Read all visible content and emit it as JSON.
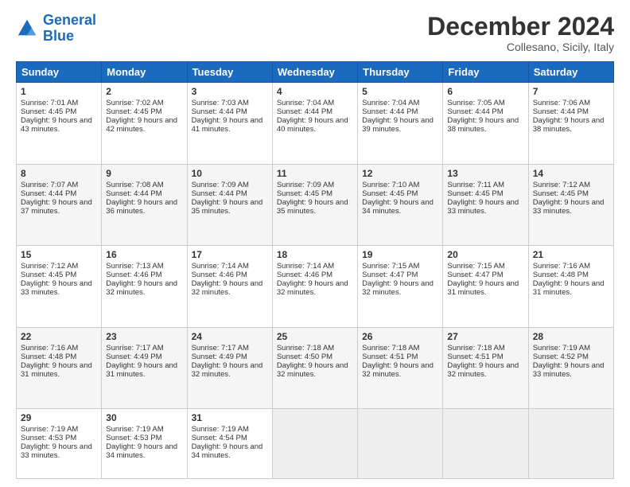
{
  "logo": {
    "line1": "General",
    "line2": "Blue"
  },
  "title": "December 2024",
  "subtitle": "Collesano, Sicily, Italy",
  "days": [
    "Sunday",
    "Monday",
    "Tuesday",
    "Wednesday",
    "Thursday",
    "Friday",
    "Saturday"
  ],
  "weeks": [
    [
      {
        "day": "1",
        "sunrise": "7:01 AM",
        "sunset": "4:45 PM",
        "daylight": "9 hours and 43 minutes."
      },
      {
        "day": "2",
        "sunrise": "7:02 AM",
        "sunset": "4:45 PM",
        "daylight": "9 hours and 42 minutes."
      },
      {
        "day": "3",
        "sunrise": "7:03 AM",
        "sunset": "4:44 PM",
        "daylight": "9 hours and 41 minutes."
      },
      {
        "day": "4",
        "sunrise": "7:04 AM",
        "sunset": "4:44 PM",
        "daylight": "9 hours and 40 minutes."
      },
      {
        "day": "5",
        "sunrise": "7:04 AM",
        "sunset": "4:44 PM",
        "daylight": "9 hours and 39 minutes."
      },
      {
        "day": "6",
        "sunrise": "7:05 AM",
        "sunset": "4:44 PM",
        "daylight": "9 hours and 38 minutes."
      },
      {
        "day": "7",
        "sunrise": "7:06 AM",
        "sunset": "4:44 PM",
        "daylight": "9 hours and 38 minutes."
      }
    ],
    [
      {
        "day": "8",
        "sunrise": "7:07 AM",
        "sunset": "4:44 PM",
        "daylight": "9 hours and 37 minutes."
      },
      {
        "day": "9",
        "sunrise": "7:08 AM",
        "sunset": "4:44 PM",
        "daylight": "9 hours and 36 minutes."
      },
      {
        "day": "10",
        "sunrise": "7:09 AM",
        "sunset": "4:44 PM",
        "daylight": "9 hours and 35 minutes."
      },
      {
        "day": "11",
        "sunrise": "7:09 AM",
        "sunset": "4:45 PM",
        "daylight": "9 hours and 35 minutes."
      },
      {
        "day": "12",
        "sunrise": "7:10 AM",
        "sunset": "4:45 PM",
        "daylight": "9 hours and 34 minutes."
      },
      {
        "day": "13",
        "sunrise": "7:11 AM",
        "sunset": "4:45 PM",
        "daylight": "9 hours and 33 minutes."
      },
      {
        "day": "14",
        "sunrise": "7:12 AM",
        "sunset": "4:45 PM",
        "daylight": "9 hours and 33 minutes."
      }
    ],
    [
      {
        "day": "15",
        "sunrise": "7:12 AM",
        "sunset": "4:45 PM",
        "daylight": "9 hours and 33 minutes."
      },
      {
        "day": "16",
        "sunrise": "7:13 AM",
        "sunset": "4:46 PM",
        "daylight": "9 hours and 32 minutes."
      },
      {
        "day": "17",
        "sunrise": "7:14 AM",
        "sunset": "4:46 PM",
        "daylight": "9 hours and 32 minutes."
      },
      {
        "day": "18",
        "sunrise": "7:14 AM",
        "sunset": "4:46 PM",
        "daylight": "9 hours and 32 minutes."
      },
      {
        "day": "19",
        "sunrise": "7:15 AM",
        "sunset": "4:47 PM",
        "daylight": "9 hours and 32 minutes."
      },
      {
        "day": "20",
        "sunrise": "7:15 AM",
        "sunset": "4:47 PM",
        "daylight": "9 hours and 31 minutes."
      },
      {
        "day": "21",
        "sunrise": "7:16 AM",
        "sunset": "4:48 PM",
        "daylight": "9 hours and 31 minutes."
      }
    ],
    [
      {
        "day": "22",
        "sunrise": "7:16 AM",
        "sunset": "4:48 PM",
        "daylight": "9 hours and 31 minutes."
      },
      {
        "day": "23",
        "sunrise": "7:17 AM",
        "sunset": "4:49 PM",
        "daylight": "9 hours and 31 minutes."
      },
      {
        "day": "24",
        "sunrise": "7:17 AM",
        "sunset": "4:49 PM",
        "daylight": "9 hours and 32 minutes."
      },
      {
        "day": "25",
        "sunrise": "7:18 AM",
        "sunset": "4:50 PM",
        "daylight": "9 hours and 32 minutes."
      },
      {
        "day": "26",
        "sunrise": "7:18 AM",
        "sunset": "4:51 PM",
        "daylight": "9 hours and 32 minutes."
      },
      {
        "day": "27",
        "sunrise": "7:18 AM",
        "sunset": "4:51 PM",
        "daylight": "9 hours and 32 minutes."
      },
      {
        "day": "28",
        "sunrise": "7:19 AM",
        "sunset": "4:52 PM",
        "daylight": "9 hours and 33 minutes."
      }
    ],
    [
      {
        "day": "29",
        "sunrise": "7:19 AM",
        "sunset": "4:53 PM",
        "daylight": "9 hours and 33 minutes."
      },
      {
        "day": "30",
        "sunrise": "7:19 AM",
        "sunset": "4:53 PM",
        "daylight": "9 hours and 34 minutes."
      },
      {
        "day": "31",
        "sunrise": "7:19 AM",
        "sunset": "4:54 PM",
        "daylight": "9 hours and 34 minutes."
      },
      null,
      null,
      null,
      null
    ]
  ]
}
